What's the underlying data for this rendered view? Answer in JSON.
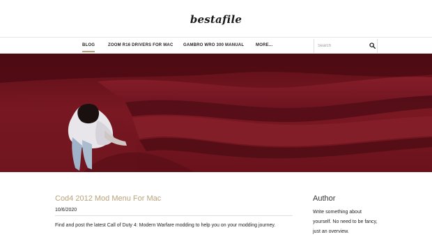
{
  "header": {
    "logo": "bestafile"
  },
  "nav": {
    "items": [
      {
        "label": "BLOG",
        "active": true
      },
      {
        "label": "ZOOM R16 DRIVERS FOR MAC",
        "active": false
      },
      {
        "label": "GAMBRO WRO 300 MANUAL",
        "active": false
      },
      {
        "label": "MORE...",
        "active": false
      }
    ]
  },
  "search": {
    "placeholder": "Search",
    "icon": "search-icon"
  },
  "hero": {
    "description_colors": {
      "carpet": "#7a1a24",
      "shadow": "#3a070d"
    }
  },
  "post": {
    "title": "Cod4 2012 Mod Menu For Mac",
    "date": "10/6/2020",
    "excerpt": "Find and post the latest Call of Duty 4: Modern Warfare modding to help you on your modding journey."
  },
  "sidebar": {
    "title": "Author",
    "text": "Write something about yourself. No need to be fancy, just an overview."
  },
  "colors": {
    "accent": "#b9a37b",
    "text": "#222222",
    "border": "#e0e0e0"
  }
}
